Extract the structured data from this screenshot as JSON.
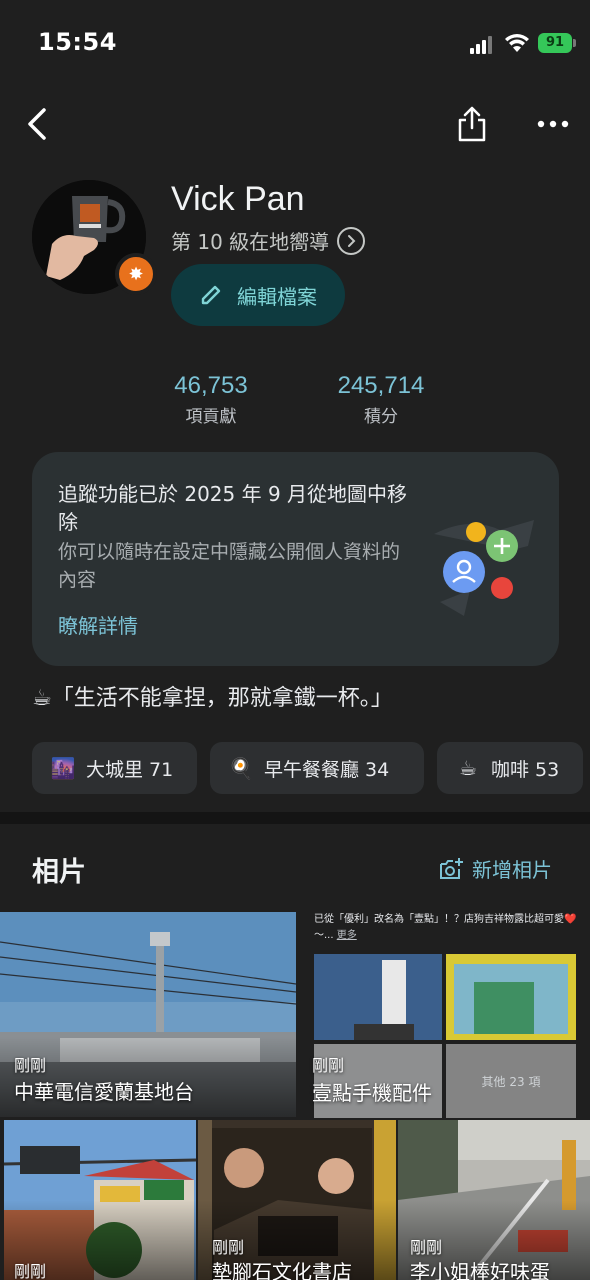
{
  "status_bar": {
    "time": "15:54",
    "battery": "91"
  },
  "nav": {
    "back_icon": "chevron-left-icon",
    "share_icon": "share-icon",
    "more_icon": "more-horizontal-icon"
  },
  "profile": {
    "name": "Vick Pan",
    "level": "第 10 級在地嚮導",
    "edit_label": "編輯檔案"
  },
  "stats": [
    {
      "value": "46,753",
      "label": "項貢獻"
    },
    {
      "value": "245,714",
      "label": "積分"
    }
  ],
  "info_card": {
    "title": "追蹤功能已於 2025 年 9 月從地圖中移除",
    "description": "你可以隨時在設定中隱藏公開個人資料的內容",
    "link": "瞭解詳情"
  },
  "bio": "☕「生活不能拿捏，那就拿鐵一杯。」",
  "chips": [
    {
      "icon": "🌆",
      "label": "大城里 71"
    },
    {
      "icon": "🍳",
      "label": "早午餐餐廳 34"
    },
    {
      "icon": "☕",
      "label": "咖啡 53"
    }
  ],
  "photos": {
    "title": "相片",
    "add_label": "新增相片",
    "post_caption": "已從「優利」改名為「壹點」！？店狗吉祥物露比超可愛❤️～...",
    "post_more": "更多",
    "more_count": "其他 23 項",
    "tiles": [
      {
        "time": "剛剛",
        "name": "中華電信愛蘭基地台"
      },
      {
        "time": "剛剛",
        "name": "壹點手機配件"
      },
      {
        "time": "剛剛",
        "name": ""
      },
      {
        "time": "剛剛",
        "name": "墊腳石文化書店"
      },
      {
        "time": "剛剛",
        "name": "李小姐棒好味蛋"
      }
    ]
  },
  "colors": {
    "accent": "#7cc3d6",
    "background": "#1f1f1f",
    "card": "#2b3133",
    "badge": "#e8711c",
    "battery": "#35c759"
  }
}
